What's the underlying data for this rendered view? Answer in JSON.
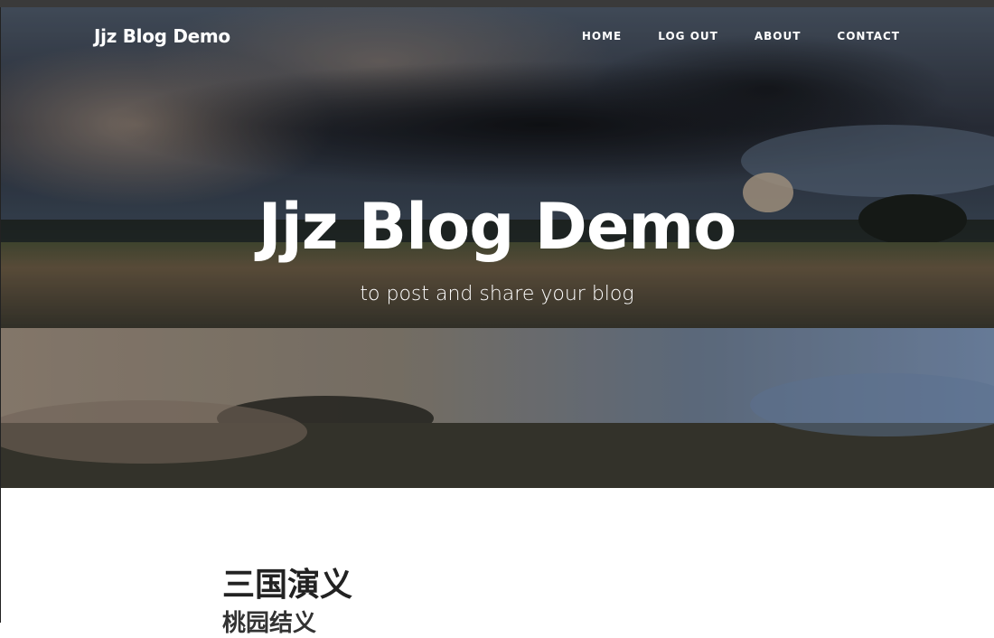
{
  "navbar": {
    "brand": "Jjz Blog Demo",
    "links": [
      "HOME",
      "LOG OUT",
      "ABOUT",
      "CONTACT"
    ]
  },
  "hero": {
    "title": "Jjz Blog Demo",
    "subtitle": "to post and share your blog"
  },
  "posts": [
    {
      "title": "三国演义",
      "subtitle": "桃园结义"
    }
  ]
}
